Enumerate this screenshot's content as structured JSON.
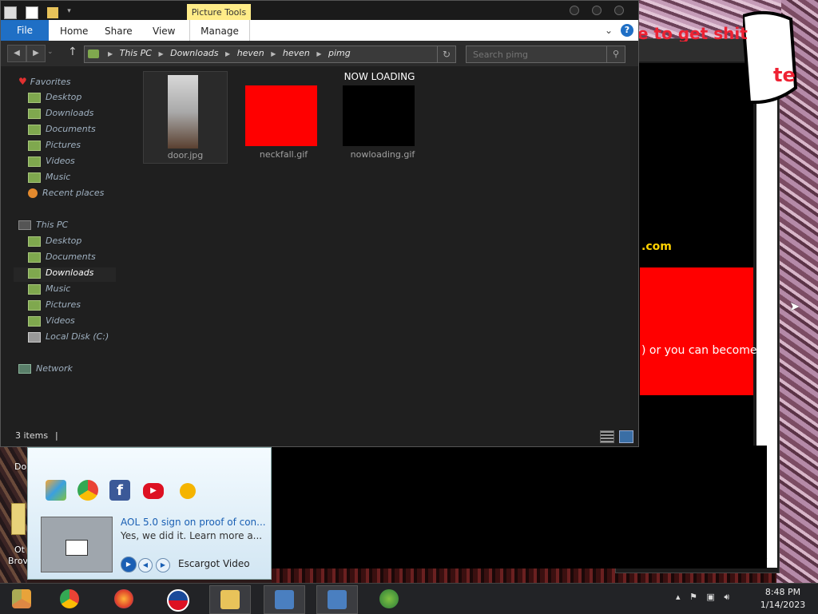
{
  "explorer": {
    "picture_tools_label": "Picture Tools",
    "ribbon_tabs": {
      "file": "File",
      "home": "Home",
      "share": "Share",
      "view": "View",
      "manage": "Manage"
    },
    "help": "?",
    "breadcrumbs": [
      "This PC",
      "Downloads",
      "heven",
      "heven",
      "pimg"
    ],
    "search_placeholder": "Search pimg",
    "nav": {
      "favorites": "Favorites",
      "favorites_items": [
        "Desktop",
        "Downloads",
        "Documents",
        "Pictures",
        "Videos",
        "Music",
        "Recent places"
      ],
      "this_pc": "This PC",
      "this_pc_items": [
        "Desktop",
        "Documents",
        "Downloads",
        "Music",
        "Pictures",
        "Videos",
        "Local Disk (C:)"
      ],
      "network": "Network",
      "selected": "Downloads"
    },
    "files": [
      {
        "name": "door.jpg"
      },
      {
        "name": "neckfall.gif"
      },
      {
        "name": "nowloading.gif",
        "overlay_label": "NOW LOADING"
      }
    ],
    "status": "3 items"
  },
  "browser": {
    "domain_fragment": ".com",
    "red_box_text": ") or you can become",
    "speech_text": "e to get shit",
    "speech_text_2": "te"
  },
  "desktop": {
    "label_1": "Do",
    "label_2": "Ot",
    "label_3": "Brov"
  },
  "gadget": {
    "video_title": "AOL 5.0 sign on proof of con...",
    "video_desc": "Yes, we did it. Learn more a...",
    "source": "Escargot Video",
    "icons": [
      "msn-butterfly-icon",
      "chrome-icon",
      "facebook-icon",
      "youtube-icon",
      "weather-sun-icon"
    ]
  },
  "taskbar": {
    "apps": [
      "chrome-canary",
      "chrome",
      "firefox",
      "obama-logo",
      "file-explorer",
      "network-tool-1",
      "network-tool-2",
      "msn-messenger"
    ],
    "time": "8:48 PM",
    "date": "1/14/2023"
  },
  "colors": {
    "accent": "#1f6fc5",
    "picture_tools": "#ffec88",
    "red": "#ff0000",
    "yellow": "#ffd200"
  }
}
